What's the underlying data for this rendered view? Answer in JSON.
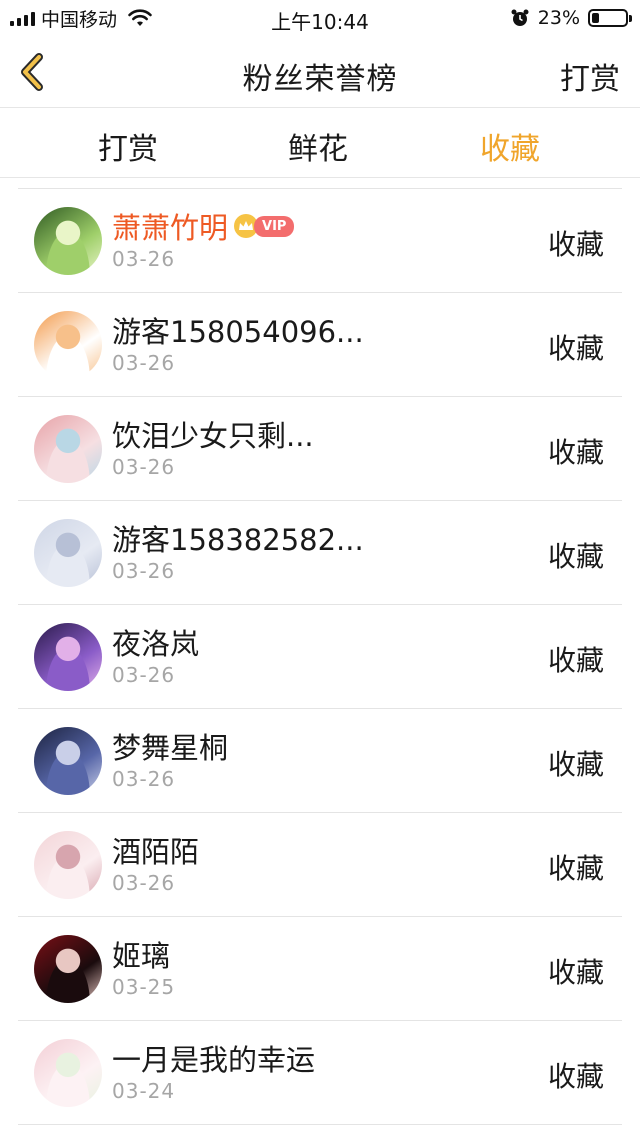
{
  "status_bar": {
    "carrier": "中国移动",
    "time": "上午10:44",
    "battery_percent": "23%",
    "battery_level": 0.23,
    "icons": [
      "signal-icon",
      "wifi-icon",
      "alarm-icon",
      "battery-icon"
    ]
  },
  "nav": {
    "back_icon": "chevron-left-icon",
    "title": "粉丝荣誉榜",
    "action_label": "打赏"
  },
  "tabs": [
    {
      "label": "打赏",
      "active": false
    },
    {
      "label": "鲜花",
      "active": false
    },
    {
      "label": "收藏",
      "active": true
    }
  ],
  "colors": {
    "accent": "#f0a52b",
    "vip_name": "#ee5a24",
    "vip_badge": "#f36d6d",
    "date_gray": "#a6a6a6"
  },
  "fans": [
    {
      "name": "萧萧竹明",
      "vip": true,
      "vip_label": "VIP",
      "date": "03-26",
      "action": "收藏",
      "avatar_colors": [
        "#2f5a22",
        "#9fcf6a",
        "#e9f5c8"
      ]
    },
    {
      "name": "游客158054096...",
      "vip": false,
      "date": "03-26",
      "action": "收藏",
      "avatar_colors": [
        "#f39a4a",
        "#ffffff",
        "#f7c08a"
      ]
    },
    {
      "name": "饮泪少女只剩...",
      "vip": false,
      "date": "03-26",
      "action": "收藏",
      "avatar_colors": [
        "#e7a3a8",
        "#f6dfe2",
        "#b9d7e5"
      ]
    },
    {
      "name": "游客158382582...",
      "vip": false,
      "date": "03-26",
      "action": "收藏",
      "avatar_colors": [
        "#cfd6e6",
        "#e6eaf3",
        "#b7c0d6"
      ]
    },
    {
      "name": "夜洛岚",
      "vip": false,
      "date": "03-26",
      "action": "收藏",
      "avatar_colors": [
        "#2a1a4a",
        "#8a5cc8",
        "#e2b0e8"
      ]
    },
    {
      "name": "梦舞星桐",
      "vip": false,
      "date": "03-26",
      "action": "收藏",
      "avatar_colors": [
        "#1c2340",
        "#5766a8",
        "#c9cfe8"
      ]
    },
    {
      "name": "酒陌陌",
      "vip": false,
      "date": "03-26",
      "action": "收藏",
      "avatar_colors": [
        "#f3d5d8",
        "#fbeef0",
        "#d7a5ae"
      ]
    },
    {
      "name": "姬璃",
      "vip": false,
      "date": "03-25",
      "action": "收藏",
      "avatar_colors": [
        "#7a0f16",
        "#1a0b0d",
        "#e8c7c2"
      ]
    },
    {
      "name": "一月是我的幸运",
      "vip": false,
      "date": "03-24",
      "action": "收藏",
      "avatar_colors": [
        "#f3cfd6",
        "#fdf2f4",
        "#e8f2e0"
      ]
    }
  ]
}
